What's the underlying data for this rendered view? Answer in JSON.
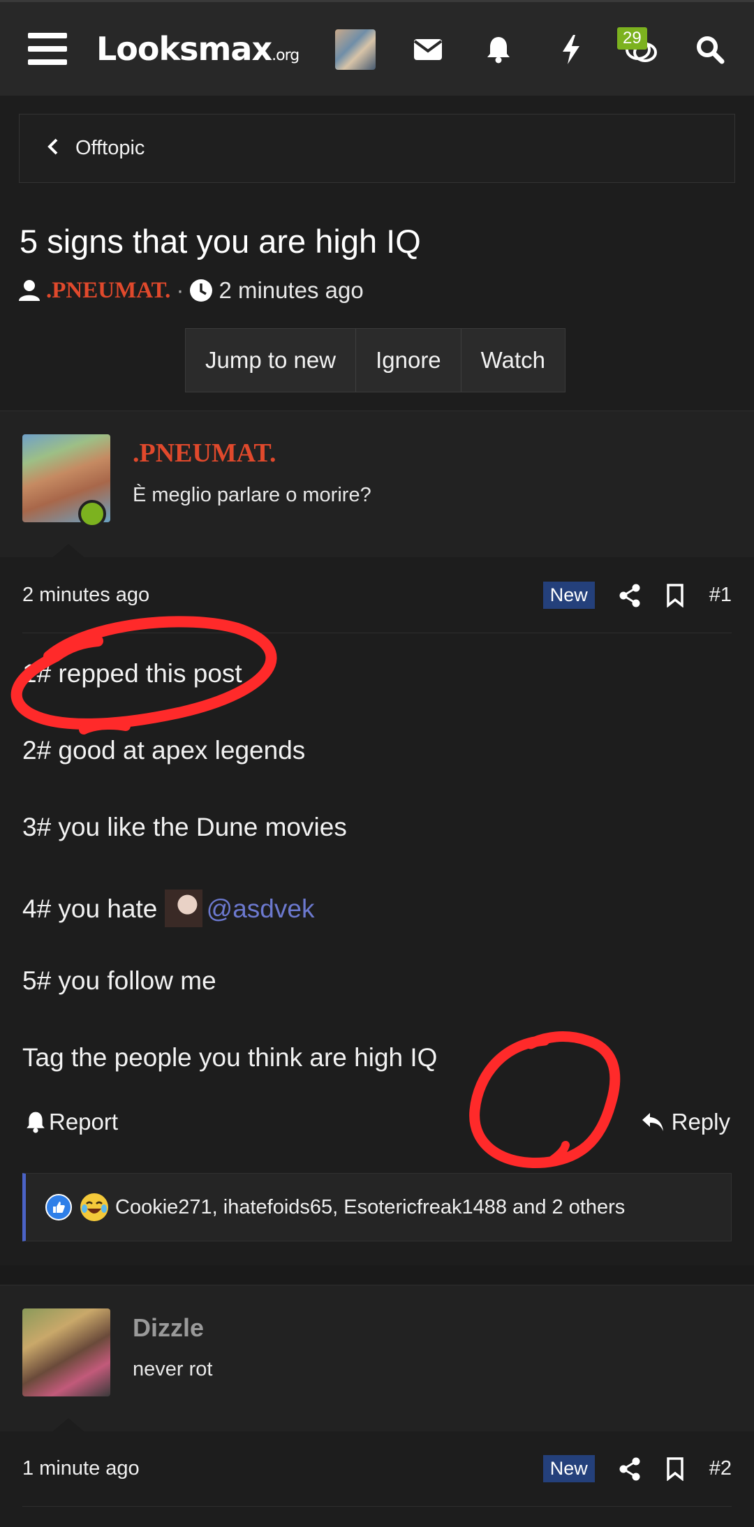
{
  "header": {
    "logo_main": "Looksmax",
    "logo_suffix": ".org",
    "conversations_badge": "29"
  },
  "breadcrumb": {
    "label": "Offtopic"
  },
  "thread": {
    "title": "5 signs that you are high IQ",
    "author": ".PNEUMAT.",
    "separator": "·",
    "time": "2 minutes ago",
    "buttons": [
      "Jump to new",
      "Ignore",
      "Watch"
    ]
  },
  "posts": [
    {
      "username": ".PNEUMAT.",
      "user_title": "È meglio parlare o morire?",
      "time": "2 minutes ago",
      "badge": "New",
      "number": "#1",
      "lines": [
        "1# repped this post",
        "2# good at apex legends",
        "3# you like the Dune movies",
        "4# you hate",
        "5# you follow me",
        "Tag the people you think are high IQ"
      ],
      "mention": "@asdvek",
      "report_label": "Report",
      "reply_label": "Reply",
      "reactions_text": "Cookie271, ihatefoids65, Esotericfreak1488 and 2 others"
    },
    {
      "username": "Dizzle",
      "user_title": "never rot",
      "time": "1 minute ago",
      "badge": "New",
      "number": "#2"
    }
  ],
  "colors": {
    "background": "#1d1d1d",
    "author_red": "#e0492c",
    "mention_blue": "#6c79cf",
    "new_badge": "#24407b",
    "online_green": "#7cb21f",
    "annotation_red": "#ff2a2a"
  },
  "icons": [
    "menu-icon",
    "envelope-icon",
    "bell-icon",
    "lightning-icon",
    "chat-icon",
    "search-icon",
    "user-icon",
    "clock-icon",
    "share-icon",
    "bookmark-icon",
    "reply-icon",
    "like-reaction-icon",
    "laugh-cry-reaction-icon"
  ]
}
